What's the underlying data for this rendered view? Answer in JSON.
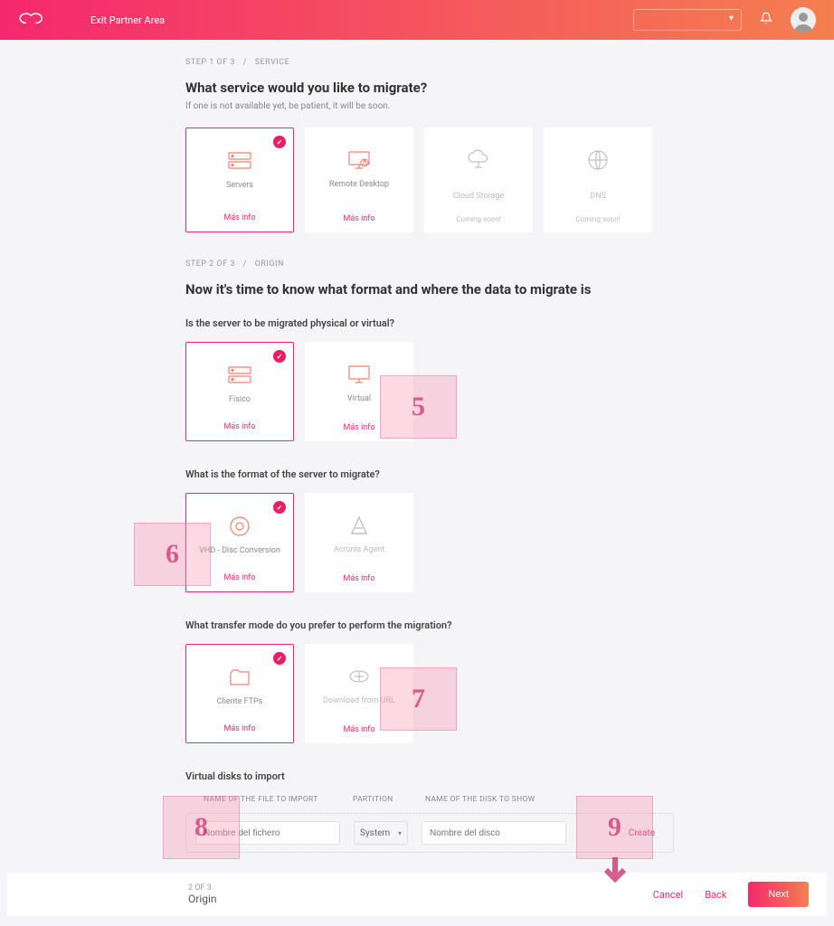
{
  "header": {
    "exit_label": "Exit Partner Area"
  },
  "step1": {
    "crumb_step": "STEP 1 OF 3",
    "crumb_sep": "/",
    "crumb_page": "SERVICE",
    "heading": "What service would you like to migrate?",
    "subtitle": "If one is not available yet, be patient, it will be soon.",
    "cards": [
      {
        "title": "Servers",
        "more": "Más info"
      },
      {
        "title": "Remote Desktop",
        "more": "Más info"
      },
      {
        "title": "Cloud Storage",
        "soon": "Coming soon!"
      },
      {
        "title": "DNS",
        "soon": "Coming soon!"
      }
    ]
  },
  "step2": {
    "crumb_step": "STEP 2 OF 3",
    "crumb_sep": "/",
    "crumb_page": "ORIGIN",
    "heading": "Now it's time to know what format and where the data to migrate is",
    "q1": "Is the server to be migrated physical or virtual?",
    "cards1": [
      {
        "title": "Físico",
        "more": "Más info"
      },
      {
        "title": "Virtual",
        "more": "Más info"
      }
    ],
    "q2": "What is the format of the server to migrate?",
    "cards2": [
      {
        "title": "VHD - Disc Conversion",
        "more": "Más info"
      },
      {
        "title": "Acronis Agent",
        "more": "Más info"
      }
    ],
    "q3": "What transfer mode do you prefer to perform the migration?",
    "cards3": [
      {
        "title": "Cliente FTPs",
        "more": "Más info"
      },
      {
        "title": "Download from URL",
        "more": "Más info"
      }
    ],
    "vd_heading": "Virtual disks to import",
    "vd_cols": {
      "file": "NAME OF THE FILE TO IMPORT",
      "partition": "PARTITION",
      "disk": "NAME OF THE DISK TO SHOW"
    },
    "vd_row": {
      "file_placeholder": "Nombre del fichero",
      "partition": "System",
      "disk_placeholder": "Nombre del disco",
      "create": "Create"
    }
  },
  "footer": {
    "step": "2 OF 3",
    "title": "Origin",
    "cancel": "Cancel",
    "back": "Back",
    "next": "Next"
  },
  "annotations": {
    "a5": "5",
    "a6": "6",
    "a7": "7",
    "a8": "8",
    "a9": "9"
  }
}
